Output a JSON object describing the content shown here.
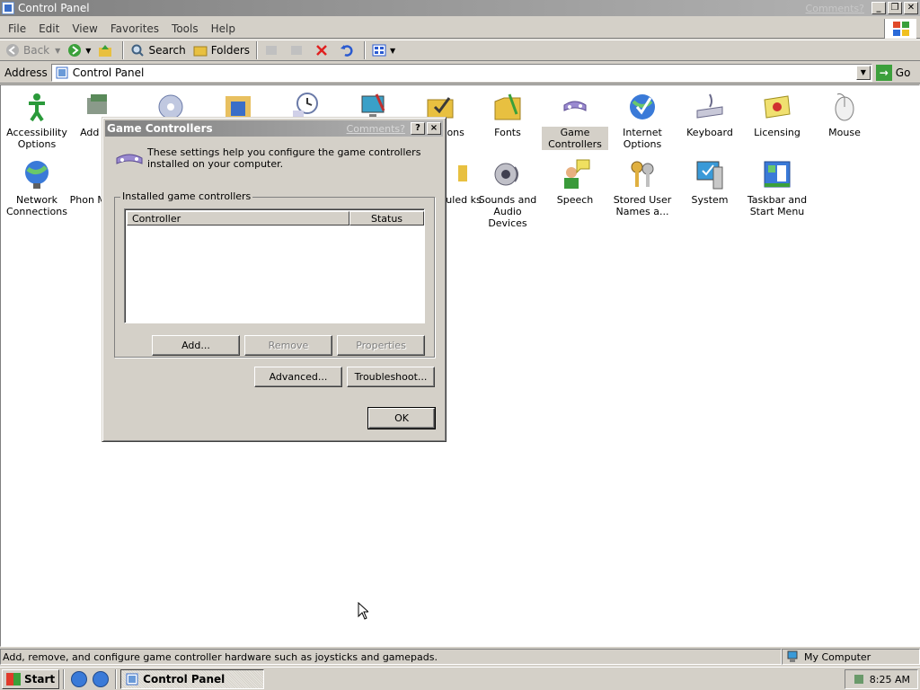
{
  "window": {
    "title": "Control Panel",
    "comments_link": "Comments?",
    "caption_buttons": [
      "minimize",
      "restore",
      "close"
    ]
  },
  "menubar": {
    "items": [
      "File",
      "Edit",
      "View",
      "Favorites",
      "Tools",
      "Help"
    ]
  },
  "toolbar": {
    "back": "Back",
    "search": "Search",
    "folders": "Folders"
  },
  "address": {
    "label": "Address",
    "value": "Control Panel",
    "go": "Go"
  },
  "control_panel": {
    "items": [
      {
        "label": "Accessibility Options",
        "icon": "accessibility-icon"
      },
      {
        "label": "Add Ha",
        "icon": "add-hardware-icon"
      },
      {
        "label": "",
        "icon": "add-remove-programs-icon"
      },
      {
        "label": "",
        "icon": "administrative-tools-icon"
      },
      {
        "label": "",
        "icon": "date-time-icon"
      },
      {
        "label": "",
        "icon": "display-icon"
      },
      {
        "label": "ptions",
        "icon": "folder-options-icon"
      },
      {
        "label": "Fonts",
        "icon": "fonts-icon"
      },
      {
        "label": "Game Controllers",
        "icon": "game-controllers-icon",
        "selected": true
      },
      {
        "label": "Internet Options",
        "icon": "internet-options-icon"
      },
      {
        "label": "Keyboard",
        "icon": "keyboard-icon"
      },
      {
        "label": "Licensing",
        "icon": "licensing-icon"
      },
      {
        "label": "Mouse",
        "icon": "mouse-icon"
      },
      {
        "label": "Network Connections",
        "icon": "network-connections-icon"
      },
      {
        "label": "Phon Mode",
        "icon": "phone-modem-icon"
      },
      {
        "label": "uled ks",
        "icon": "scheduled-tasks-icon"
      },
      {
        "label": "Sounds and Audio Devices",
        "icon": "sounds-icon"
      },
      {
        "label": "Speech",
        "icon": "speech-icon"
      },
      {
        "label": "Stored User Names a...",
        "icon": "stored-user-names-icon"
      },
      {
        "label": "System",
        "icon": "system-icon"
      },
      {
        "label": "Taskbar and Start Menu",
        "icon": "taskbar-start-menu-icon"
      }
    ]
  },
  "dialog": {
    "title": "Game Controllers",
    "comments": "Comments?",
    "help_btn": "?",
    "close_btn": "×",
    "description": "These settings help you configure the game controllers installed on your computer.",
    "group_label": "Installed game controllers",
    "columns": [
      "Controller",
      "Status"
    ],
    "rows": [],
    "buttons": {
      "add": "Add...",
      "remove": "Remove",
      "properties": "Properties",
      "advanced": "Advanced...",
      "troubleshoot": "Troubleshoot...",
      "ok": "OK"
    }
  },
  "statusbar": {
    "text": "Add, remove, and configure game controller hardware such as joysticks and gamepads.",
    "zone": "My Computer"
  },
  "taskbar": {
    "start": "Start",
    "task": "Control Panel",
    "clock": "8:25 AM"
  }
}
